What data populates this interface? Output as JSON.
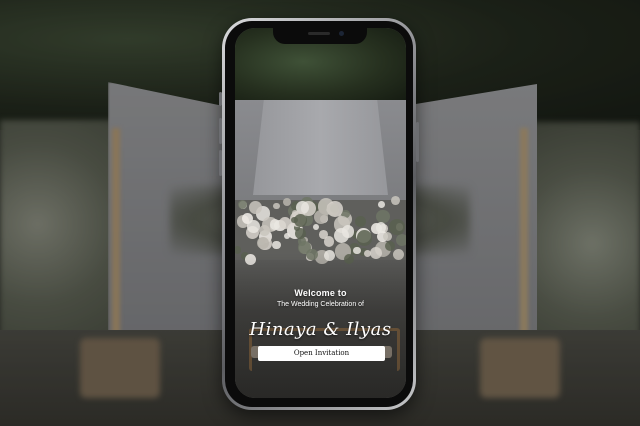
{
  "invitation": {
    "welcome": "Welcome to",
    "subtitle": "The Wedding Celebration of",
    "couple_names": "Hinaya & Ilyas",
    "open_button_label": "Open Invitation"
  },
  "colors": {
    "button_background": "#ffffff",
    "button_text": "#111111",
    "text_on_photo": "#ffffff",
    "phone_frame": "#8b8c90"
  }
}
